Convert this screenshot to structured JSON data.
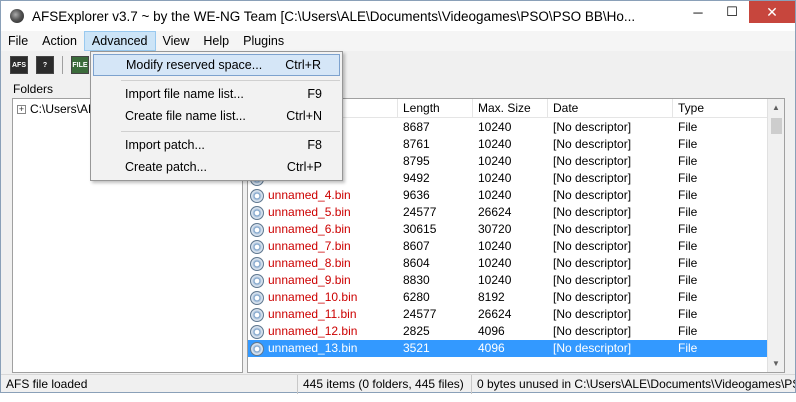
{
  "window": {
    "title": "AFSExplorer v3.7  ~ by the WE-NG Team [C:\\Users\\ALE\\Documents\\Videogames\\PSO\\PSO BB\\Ho...",
    "minimize": "─",
    "maximize": "☐",
    "close": "✕"
  },
  "menubar": [
    "File",
    "Action",
    "Advanced",
    "View",
    "Help",
    "Plugins"
  ],
  "toolbar": {
    "buttons": [
      {
        "icon": "afs-icon",
        "label": "AFS"
      },
      {
        "icon": "help-icon",
        "label": "?"
      },
      {
        "icon": "file-icon",
        "label": "FILE"
      }
    ]
  },
  "folders": {
    "label": "Folders",
    "root_path": "C:\\Users\\ALE",
    "expander": "+"
  },
  "list": {
    "columns": [
      "",
      "Length",
      "Max. Size",
      "Date",
      "Type"
    ],
    "rows": [
      {
        "name": "",
        "length": "8687",
        "max": "10240",
        "date": "[No descriptor]",
        "type": "File"
      },
      {
        "name": "",
        "length": "8761",
        "max": "10240",
        "date": "[No descriptor]",
        "type": "File"
      },
      {
        "name": "",
        "length": "8795",
        "max": "10240",
        "date": "[No descriptor]",
        "type": "File"
      },
      {
        "name": "",
        "length": "9492",
        "max": "10240",
        "date": "[No descriptor]",
        "type": "File"
      },
      {
        "name": "unnamed_4.bin",
        "length": "9636",
        "max": "10240",
        "date": "[No descriptor]",
        "type": "File"
      },
      {
        "name": "unnamed_5.bin",
        "length": "24577",
        "max": "26624",
        "date": "[No descriptor]",
        "type": "File"
      },
      {
        "name": "unnamed_6.bin",
        "length": "30615",
        "max": "30720",
        "date": "[No descriptor]",
        "type": "File"
      },
      {
        "name": "unnamed_7.bin",
        "length": "8607",
        "max": "10240",
        "date": "[No descriptor]",
        "type": "File"
      },
      {
        "name": "unnamed_8.bin",
        "length": "8604",
        "max": "10240",
        "date": "[No descriptor]",
        "type": "File"
      },
      {
        "name": "unnamed_9.bin",
        "length": "8830",
        "max": "10240",
        "date": "[No descriptor]",
        "type": "File"
      },
      {
        "name": "unnamed_10.bin",
        "length": "6280",
        "max": "8192",
        "date": "[No descriptor]",
        "type": "File"
      },
      {
        "name": "unnamed_11.bin",
        "length": "24577",
        "max": "26624",
        "date": "[No descriptor]",
        "type": "File"
      },
      {
        "name": "unnamed_12.bin",
        "length": "2825",
        "max": "4096",
        "date": "[No descriptor]",
        "type": "File"
      },
      {
        "name": "unnamed_13.bin",
        "length": "3521",
        "max": "4096",
        "date": "[No descriptor]",
        "type": "File",
        "selected": true
      }
    ]
  },
  "dropdown": {
    "items": [
      {
        "label": "Modify reserved space...",
        "shortcut": "Ctrl+R",
        "hover": true
      },
      {
        "label": "Import file name list...",
        "shortcut": "F9"
      },
      {
        "label": "Create file name list...",
        "shortcut": "Ctrl+N"
      },
      {
        "label": "Import patch...",
        "shortcut": "F8"
      },
      {
        "label": "Create patch...",
        "shortcut": "Ctrl+P"
      }
    ]
  },
  "status": {
    "left": "AFS file loaded",
    "middle": "445 items (0 folders, 445 files)",
    "right": "0 bytes unused in C:\\Users\\ALE\\Documents\\Videogames\\PSO\\PS"
  },
  "colors": {
    "selection": "#3399ff",
    "filename_red": "#cc0000",
    "menu_hover": "#d5e6f7",
    "close_button": "#c7463d"
  }
}
